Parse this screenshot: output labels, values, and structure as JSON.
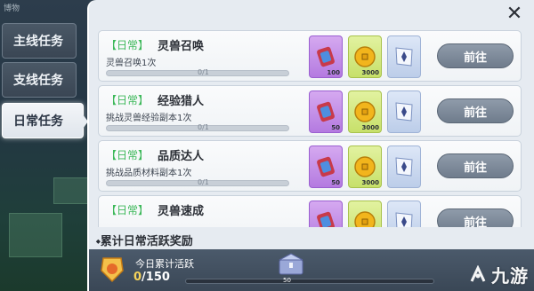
{
  "backdrop": {
    "tiny_label": "博物"
  },
  "tabs": [
    {
      "label": "主线任务",
      "active": false
    },
    {
      "label": "支线任务",
      "active": false
    },
    {
      "label": "日常任务",
      "active": true
    }
  ],
  "tasks": [
    {
      "tag": "【日常】",
      "name": "灵兽召唤",
      "desc": "灵兽召唤1次",
      "progress": "0/1",
      "rewards": [
        {
          "type": "purple",
          "num": "100"
        },
        {
          "type": "green",
          "num": "3000"
        },
        {
          "type": "blue",
          "num": ""
        }
      ],
      "button": "前往"
    },
    {
      "tag": "【日常】",
      "name": "经验猎人",
      "desc": "挑战灵兽经验副本1次",
      "progress": "0/1",
      "rewards": [
        {
          "type": "purple",
          "num": "50"
        },
        {
          "type": "green",
          "num": "3000"
        },
        {
          "type": "blue",
          "num": ""
        }
      ],
      "button": "前往"
    },
    {
      "tag": "【日常】",
      "name": "品质达人",
      "desc": "挑战品质材料副本1次",
      "progress": "0/1",
      "rewards": [
        {
          "type": "purple",
          "num": "50"
        },
        {
          "type": "green",
          "num": "3000"
        },
        {
          "type": "blue",
          "num": ""
        }
      ],
      "button": "前往"
    },
    {
      "tag": "【日常】",
      "name": "灵兽速成",
      "desc": "",
      "progress": "",
      "rewards": [
        {
          "type": "purple",
          "num": ""
        },
        {
          "type": "green",
          "num": ""
        },
        {
          "type": "blue",
          "num": ""
        }
      ],
      "button": "前往"
    }
  ],
  "footer": {
    "title": "累计日常活跃奖励",
    "today_label": "今日累计活跃",
    "current": "0",
    "total": "/150",
    "milestone_label": "50"
  },
  "watermark": "九游",
  "colors": {
    "tag_green": "#3db85a",
    "goto_button": "#7f8b9a",
    "panel_bg": "#e6ebf1"
  }
}
